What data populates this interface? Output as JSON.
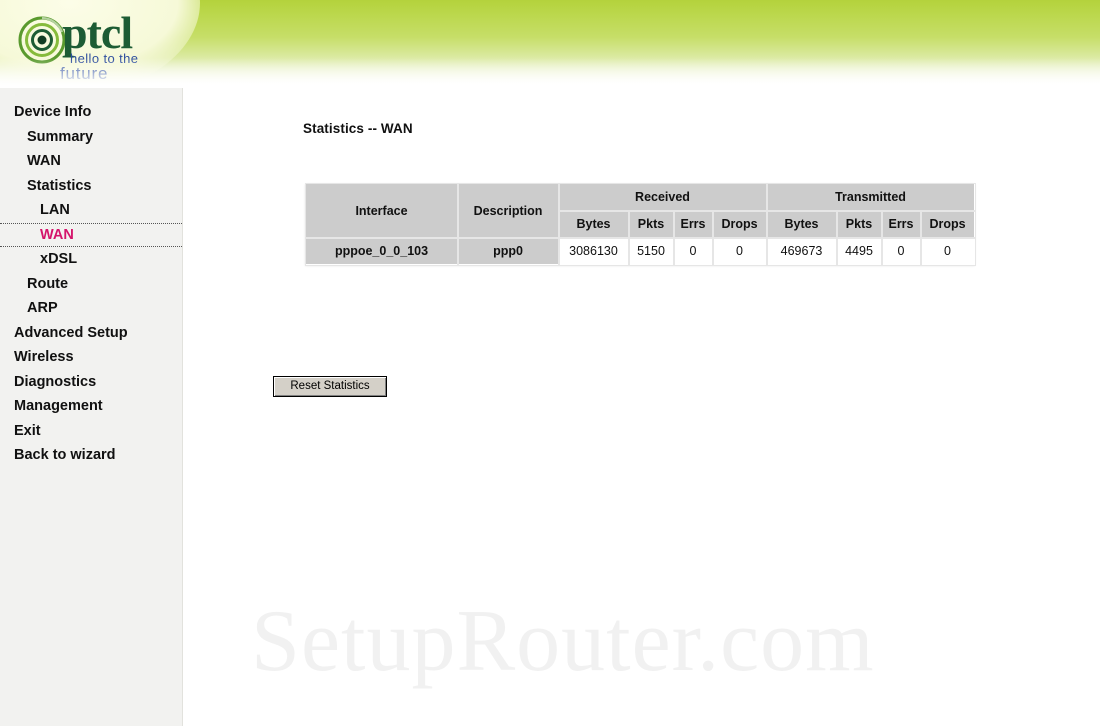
{
  "header": {
    "logo": {
      "brand": "ptcl",
      "tagline_line1": "hello to the",
      "tagline_line2": "future",
      "icon_name": "ptcl-spiral-eye-logo"
    },
    "colors": {
      "banner_green": "#b4d23c",
      "banner_dark_green": "#93bf2f",
      "brand_text": "#1d5c34",
      "tagline_text": "#2f4f9e"
    }
  },
  "sidebar": {
    "items": [
      {
        "label": "Device Info",
        "level": 0,
        "active": false
      },
      {
        "label": "Summary",
        "level": 1,
        "active": false
      },
      {
        "label": "WAN",
        "level": 1,
        "active": false
      },
      {
        "label": "Statistics",
        "level": 1,
        "active": false
      },
      {
        "label": "LAN",
        "level": 2,
        "active": false
      },
      {
        "label": "WAN",
        "level": 2,
        "active": true
      },
      {
        "label": "xDSL",
        "level": 2,
        "active": false
      },
      {
        "label": "Route",
        "level": 1,
        "active": false
      },
      {
        "label": "ARP",
        "level": 1,
        "active": false
      },
      {
        "label": "Advanced Setup",
        "level": 0,
        "active": false
      },
      {
        "label": "Wireless",
        "level": 0,
        "active": false
      },
      {
        "label": "Diagnostics",
        "level": 0,
        "active": false
      },
      {
        "label": "Management",
        "level": 0,
        "active": false
      },
      {
        "label": "Exit",
        "level": 0,
        "active": false
      },
      {
        "label": "Back to wizard",
        "level": 0,
        "active": false
      }
    ],
    "active_color": "#d4146b"
  },
  "main": {
    "page_title": "Statistics -- WAN",
    "table": {
      "group_headers": {
        "interface": "Interface",
        "description": "Description",
        "received": "Received",
        "transmitted": "Transmitted"
      },
      "sub_headers": [
        "Bytes",
        "Pkts",
        "Errs",
        "Drops"
      ],
      "rows": [
        {
          "interface": "pppoe_0_0_103",
          "description": "ppp0",
          "received": {
            "bytes": "3086130",
            "pkts": "5150",
            "errs": "0",
            "drops": "0"
          },
          "transmitted": {
            "bytes": "469673",
            "pkts": "4495",
            "errs": "0",
            "drops": "0"
          }
        }
      ]
    },
    "reset_button_label": "Reset Statistics"
  },
  "watermark": {
    "text": "SetupRouter.com"
  }
}
